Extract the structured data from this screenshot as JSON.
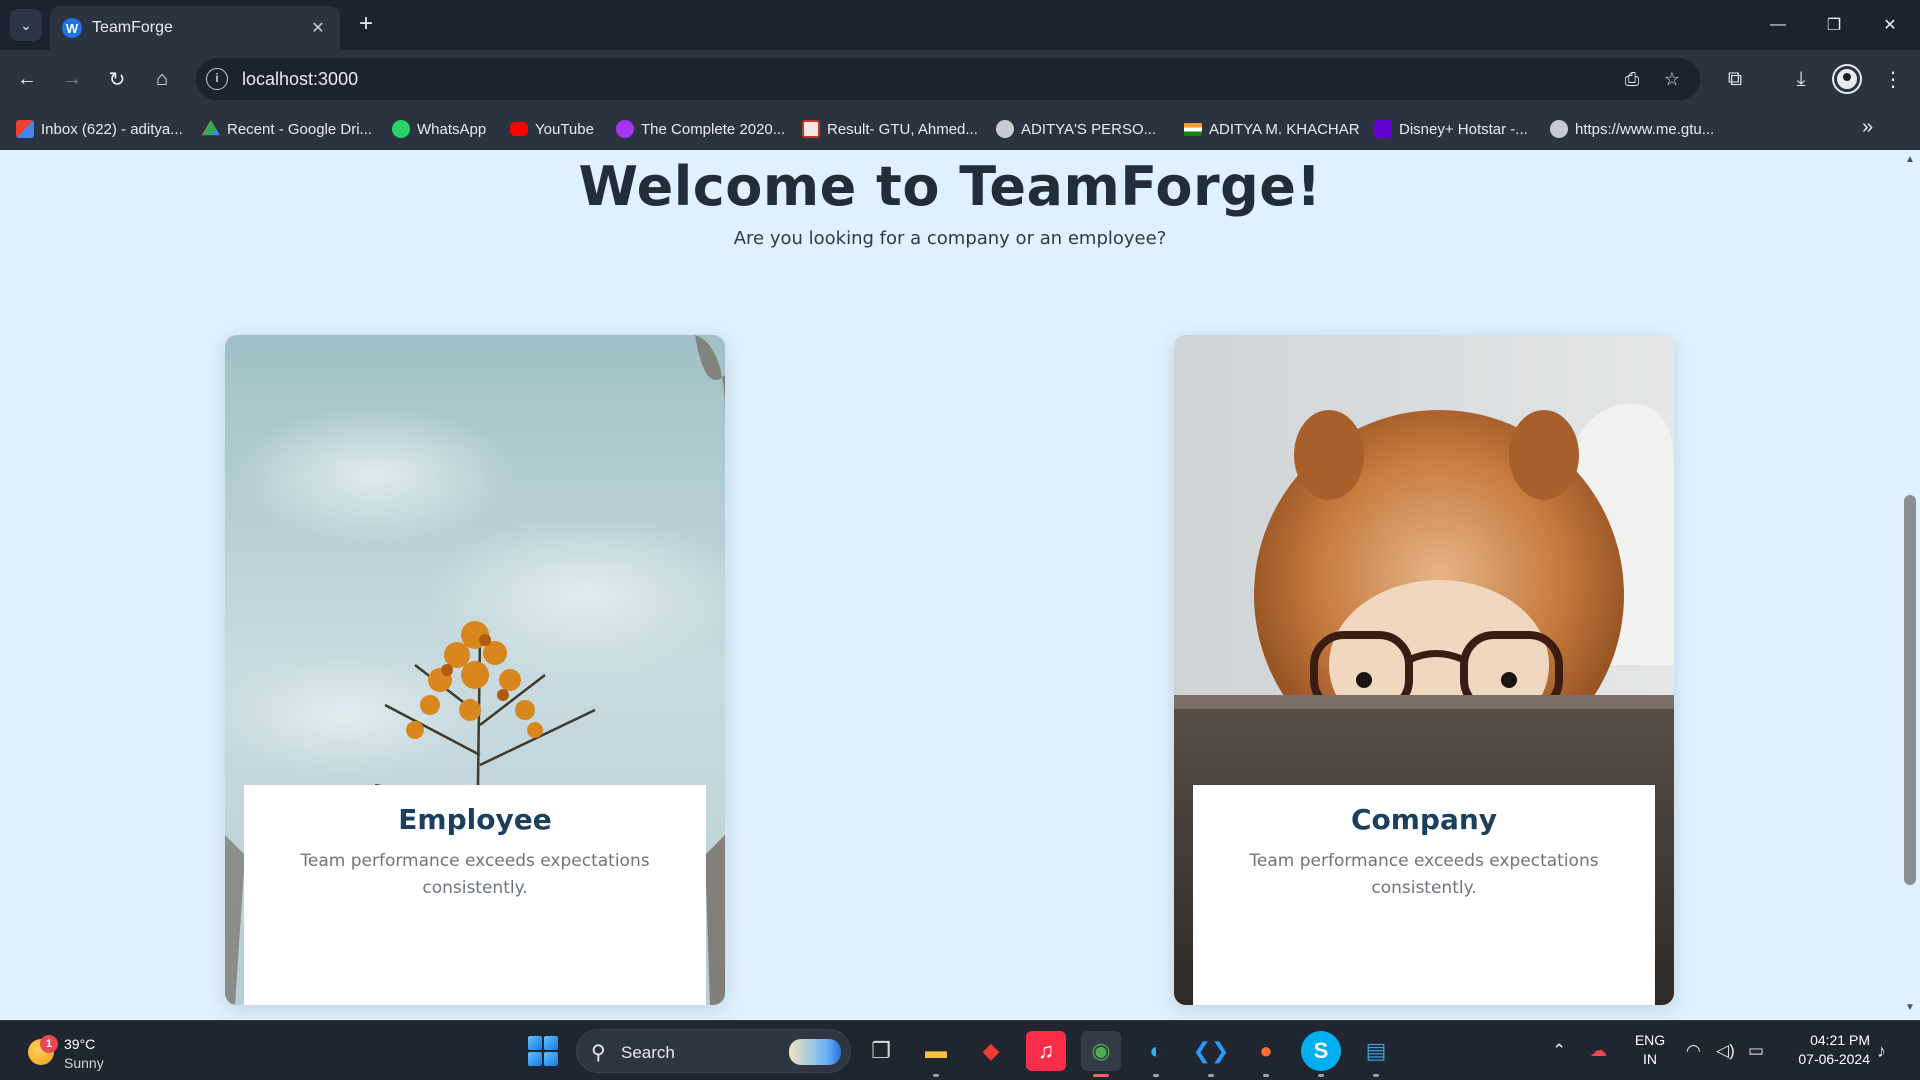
{
  "browser": {
    "tab_title": "TeamForge",
    "tab_favicon_letter": "W",
    "url": "localhost:3000",
    "bookmarks": [
      {
        "label": "Inbox (622) - aditya...",
        "icon": "gmail-icon",
        "color": "#ea4335"
      },
      {
        "label": "Recent - Google Dri...",
        "icon": "google-drive-icon",
        "color": "#34a853"
      },
      {
        "label": "WhatsApp",
        "icon": "whatsapp-icon",
        "color": "#25d366"
      },
      {
        "label": "YouTube",
        "icon": "youtube-icon",
        "color": "#ff0000"
      },
      {
        "label": "The Complete 2020...",
        "icon": "udemy-icon",
        "color": "#a435f0"
      },
      {
        "label": "Result- GTU, Ahmed...",
        "icon": "gtu-icon",
        "color": "#c0392b"
      },
      {
        "label": "ADITYA'S PERSO...",
        "icon": "globe-icon",
        "color": "#c8ccd2"
      },
      {
        "label": "ADITYA M. KHACHAR",
        "icon": "india-flag-icon",
        "color": "#ff9933"
      },
      {
        "label": "Disney+ Hotstar -...",
        "icon": "yahoo-icon",
        "color": "#6001d2"
      },
      {
        "label": "https://www.me.gtu...",
        "icon": "globe-icon",
        "color": "#c8ccd2"
      }
    ]
  },
  "page": {
    "title": "Welcome to TeamForge!",
    "subtitle": "Are you looking for a company or an employee?",
    "cards": [
      {
        "title": "Employee",
        "text": "Team performance exceeds expectations consistently.",
        "image": "orange-flower-plant-photo"
      },
      {
        "title": "Company",
        "text": "Team performance exceeds expectations consistently.",
        "image": "dog-with-glasses-photo"
      }
    ]
  },
  "taskbar": {
    "weather_temp": "39°C",
    "weather_condition": "Sunny",
    "weather_badge": "1",
    "search_label": "Search",
    "language_line1": "ENG",
    "language_line2": "IN",
    "time": "04:21 PM",
    "date": "07-06-2024"
  },
  "colors": {
    "page_background": "#dff1fd",
    "card_title": "#1c3f5e",
    "chrome_dark": "#1b2230",
    "chrome_toolbar": "#2b3340"
  }
}
